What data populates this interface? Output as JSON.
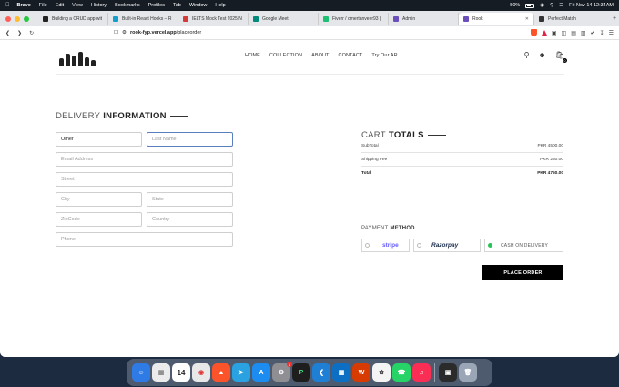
{
  "menubar": {
    "app": "Brave",
    "items": [
      "File",
      "Edit",
      "View",
      "History",
      "Bookmarks",
      "Profiles",
      "Tab",
      "Window",
      "Help"
    ],
    "battery": "50%",
    "datetime": "Fri Nov 14  12:34AM"
  },
  "tabs": [
    {
      "label": "Building a CRUD app wit",
      "color": "#222222"
    },
    {
      "label": "Built-in React Hooks – R",
      "color": "#149eca"
    },
    {
      "label": "IELTS Mock Test 2025 N",
      "color": "#d33b3b"
    },
    {
      "label": "Google Meet",
      "color": "#00897b"
    },
    {
      "label": "Fiverr / omertanveer93 |",
      "color": "#1dbf73"
    },
    {
      "label": "Admin",
      "color": "#6b4fbb"
    },
    {
      "label": "Rook",
      "color": "#6b4fbb"
    },
    {
      "label": "Perfect Match",
      "color": "#333333"
    }
  ],
  "address_bar": {
    "domain": "rook-fyp.vercel.app",
    "path": "/placeorder"
  },
  "nav": {
    "links": [
      "HOME",
      "COLLECTION",
      "ABOUT",
      "CONTACT",
      "Try Our AR"
    ],
    "cart_count": "0"
  },
  "delivery": {
    "title_light": "DELIVERY",
    "title_bold": "INFORMATION",
    "first_name": "Omer",
    "last_name_placeholder": "Last Name",
    "email_placeholder": "Email Address",
    "street_placeholder": "Street",
    "city_placeholder": "City",
    "state_placeholder": "State",
    "zip_placeholder": "ZipCode",
    "country_placeholder": "Country",
    "phone_placeholder": "Phone"
  },
  "cart": {
    "title_light": "CART",
    "title_bold": "TOTALS",
    "subtotal_label": "SubTotal",
    "subtotal_value": "PKR 4500.00",
    "shipping_label": "Shipping Fee",
    "shipping_value": "PKR 250.00",
    "total_label": "Total",
    "total_value": "PKR 4750.00"
  },
  "payment": {
    "title_light": "PAYMENT",
    "title_bold": "METHOD",
    "stripe": "stripe",
    "razorpay": "Razorpay",
    "cod": "CASH ON DELIVERY",
    "selected": "cod"
  },
  "place_order_label": "PLACE ORDER",
  "dock": {
    "calendar_day": "14",
    "mail_badge": "1"
  }
}
